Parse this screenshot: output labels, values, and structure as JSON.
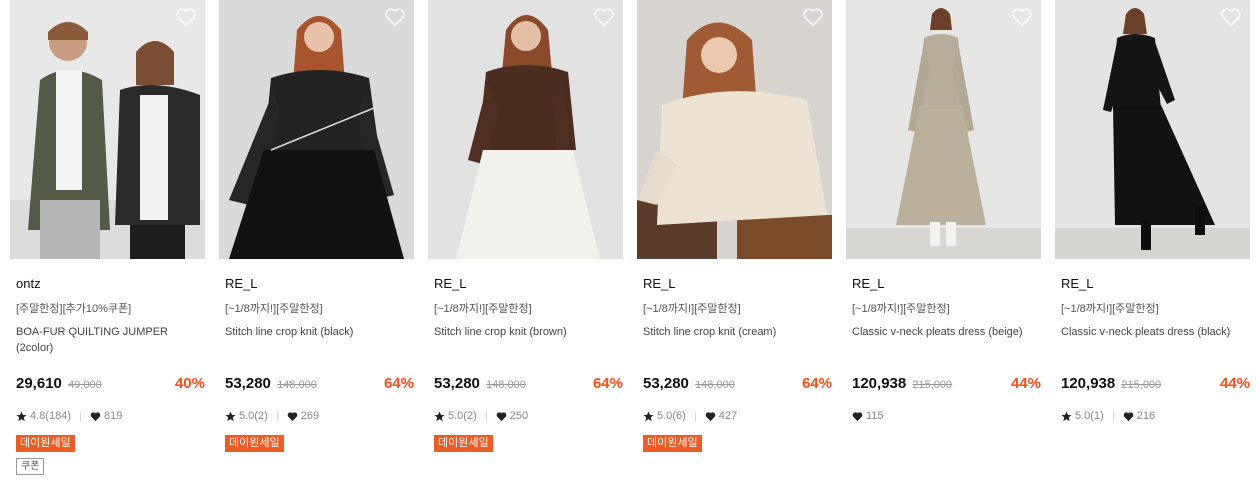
{
  "products": [
    {
      "brand": "ontz",
      "promo": "[주말한정][추가10%쿠폰]",
      "name": "BOA-FUR QUILTING JUMPER (2color)",
      "price": "29,610",
      "original_price": "49,000",
      "discount": "40%",
      "rating": "4.8(184)",
      "likes": "819",
      "badge": "데이원세일",
      "coupon": "쿠폰"
    },
    {
      "brand": "RE_L",
      "promo": "[~1/8까지!][주말한정]",
      "name": "Stitch line crop knit (black)",
      "price": "53,280",
      "original_price": "148,000",
      "discount": "64%",
      "rating": "5.0(2)",
      "likes": "269",
      "badge": "데이원세일"
    },
    {
      "brand": "RE_L",
      "promo": "[~1/8까지!][주말한정]",
      "name": "Stitch line crop knit (brown)",
      "price": "53,280",
      "original_price": "148,000",
      "discount": "64%",
      "rating": "5.0(2)",
      "likes": "250",
      "badge": "데이원세일"
    },
    {
      "brand": "RE_L",
      "promo": "[~1/8까지!][주말한정]",
      "name": "Stitch line crop knit (cream)",
      "price": "53,280",
      "original_price": "148,000",
      "discount": "64%",
      "rating": "5.0(6)",
      "likes": "427",
      "badge": "데이원세일"
    },
    {
      "brand": "RE_L",
      "promo": "[~1/8까지!][주말한정]",
      "name": "Classic v-neck pleats dress (beige)",
      "price": "120,938",
      "original_price": "215,000",
      "discount": "44%",
      "likes": "115"
    },
    {
      "brand": "RE_L",
      "promo": "[~1/8까지!][주말한정]",
      "name": "Classic v-neck pleats dress (black)",
      "price": "120,938",
      "original_price": "215,000",
      "discount": "44%",
      "rating": "5.0(1)",
      "likes": "216"
    }
  ],
  "icons": {
    "wishlist": "heart-outline-icon",
    "rating": "star-icon",
    "likes": "heart-filled-icon"
  },
  "colors": {
    "discount": "#ff4d17",
    "badge": "#ec5c24"
  }
}
